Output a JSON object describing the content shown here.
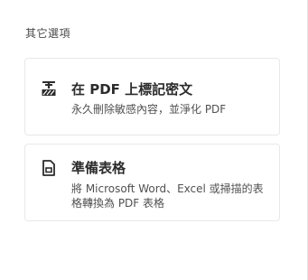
{
  "section": {
    "title": "其它選項"
  },
  "options": [
    {
      "title": "在 PDF 上標記密文",
      "description": "永久刪除敏感內容，並淨化 PDF",
      "icon": "redact-icon"
    },
    {
      "title": "準備表格",
      "description": "將 Microsoft Word、Excel 或掃描的表格轉換為 PDF 表格",
      "icon": "prepare-form-icon"
    }
  ],
  "colors": {
    "text": "#2c2c2c",
    "muted_text": "#505050",
    "card_border": "#e8e8e8",
    "background": "#ffffff"
  }
}
